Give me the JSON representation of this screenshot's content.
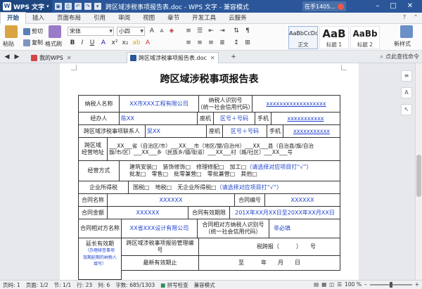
{
  "app": {
    "logo_label": "WPS 文字",
    "window_title": "跨区域涉税事项报告表.doc - WPS 文字 - 兼容模式",
    "user_label": "在手1405...",
    "min_symbol": "–",
    "max_symbol": "□",
    "close_symbol": "✕"
  },
  "menu": {
    "tabs": [
      "开始",
      "插入",
      "页面布局",
      "引用",
      "审阅",
      "视图",
      "章节",
      "开发工具",
      "云服务"
    ],
    "active_index": 0
  },
  "ribbon": {
    "paste_label": "粘贴",
    "cut_label": "剪切",
    "copy_label": "复制",
    "format_painter_label": "格式刷",
    "font_name": "宋体",
    "font_size": "小四",
    "styles": [
      {
        "sample": "AaBbCcDd",
        "name": "正文"
      },
      {
        "sample": "AaB",
        "name": "标题 1"
      },
      {
        "sample": "AaBb",
        "name": "标题 2"
      }
    ],
    "new_style_label": "新样式"
  },
  "docbar": {
    "home_tab": "我的WPS",
    "doc_tab": "跨区域涉税事项报告表.doc",
    "new_tab_symbol": "+",
    "search_label": "点此查找命令"
  },
  "document": {
    "title": "跨区域涉税事项报告表",
    "taxpayer_name_label": "纳税人名称",
    "taxpayer_name_value": "XX市XXX工程有限公司",
    "tax_id_label_l1": "纳税人识别号",
    "tax_id_label_l2": "（统一社会信用代码）",
    "tax_id_value": "xxxxxxxxxxxxxxxxxx",
    "manager_label": "经办人",
    "manager_value": "陈XX",
    "landline_label": "座机",
    "manager_landline_value": "区号＋号码",
    "mobile_label": "手机",
    "manager_mobile_value": "xxxxxxxxxxx",
    "contact_label": "跨区域涉税事项联系人",
    "contact_value": "吴XX",
    "contact_landline_value": "区号＋号码",
    "contact_mobile_value": "xxxxxxxxxxx",
    "address_label_l1": "跨区域",
    "address_label_l2": "经营地址",
    "address_line1": "___XX___省（自治区/市）___XX___市（地区/盟/自治州）___XX___县（自治县/旗/自治",
    "address_line2": "旗/市/区）___XX___乡（民族乡/镇/街道）___XX___村（路/社区）___XX___号",
    "mode_label": "经营方式",
    "mode_line1": "建筑安装□　装饰修饰□　修理修配□　加工□",
    "mode_line1_note": "（请选择对应项目打“√”）",
    "mode_line2": "批发□　零售□　批零兼营□　零批兼营□　其他□",
    "income_label": "企业所得税",
    "income_options": "国税□　地税□　无企业所得税□",
    "income_note": "（请选择对应项目打“√”）",
    "contract_name_label": "合同名称",
    "contract_name_value": "XXXXXX",
    "contract_no_label": "合同编号",
    "contract_no_value": "XXXXXX",
    "contract_amount_label": "合同金额",
    "contract_amount_value": "XXXXXX",
    "contract_period_label": "合同有效期限",
    "contract_period_value": "201X年XX月XX日至20XX年XX月XX日",
    "counterparty_label": "合同相对方名称",
    "counterparty_value": "XX省XXX设计有限公司",
    "counterparty_id_label_l1": "合同相对方纳税人识别号",
    "counterparty_id_label_l2": "（统一社会信用代码）",
    "counterparty_id_value": "非必填",
    "extension_label": "延长有效期",
    "extension_note_l1": "（办理续签事项",
    "extension_note_l2": "效期延期的纳税人",
    "extension_note_l3": "填写）",
    "report_id_label_l1": "跨区域涉税事项报验管理编",
    "report_id_label_l2": "号",
    "report_id_value": "税跨报（　　　）　　号",
    "latest_deadline_label": "最新有效期止",
    "latest_deadline_value": "至　　　年　　月　　日"
  },
  "status": {
    "page_no": "页码: 1",
    "pages": "页面: 1/2",
    "section": "节: 1/1",
    "row": "行: 23",
    "col": "列: 6",
    "words": "字数: 685/1303",
    "spell_check": "拼写检查",
    "compat_mode": "兼容模式",
    "zoom": "100 %",
    "zoom_out": "–",
    "zoom_in": "+",
    "zoom_fraction": 0.5
  }
}
